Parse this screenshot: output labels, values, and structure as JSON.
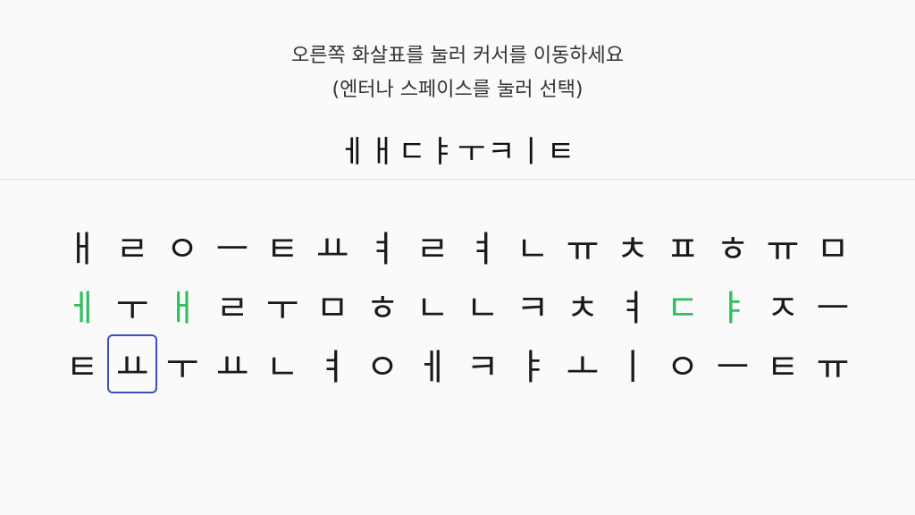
{
  "instructions": {
    "line1": "오른쪽 화살표를 눌러 커서를 이동하세요",
    "line2": "(엔터나 스페이스를 눌러 선택)"
  },
  "target_word": "ㅔㅐㄷㅑㅜㅋㅣㅌ",
  "colors": {
    "found": "#2fbf5f",
    "cursor_border": "#3a4fc2",
    "text": "#1a1a1a"
  },
  "grid": {
    "rows": [
      [
        "ㅐ",
        "ㄹ",
        "ㅇ",
        "ㅡ",
        "ㅌ",
        "ㅛ",
        "ㅕ",
        "ㄹ",
        "ㅕ",
        "ㄴ",
        "ㅠ",
        "ㅊ",
        "ㅍ",
        "ㅎ",
        "ㅠ",
        "ㅁ"
      ],
      [
        "ㅔ",
        "ㅜ",
        "ㅐ",
        "ㄹ",
        "ㅜ",
        "ㅁ",
        "ㅎ",
        "ㄴ",
        "ㄴ",
        "ㅋ",
        "ㅊ",
        "ㅕ",
        "ㄷ",
        "ㅑ",
        "ㅈ",
        "ㅡ"
      ],
      [
        "ㅌ",
        "ㅛ",
        "ㅜ",
        "ㅛ",
        "ㄴ",
        "ㅕ",
        "ㅇ",
        "ㅔ",
        "ㅋ",
        "ㅑ",
        "ㅗ",
        "ㅣ",
        "ㅇ",
        "ㅡ",
        "ㅌ",
        "ㅠ"
      ]
    ],
    "found": [
      [
        1,
        0
      ],
      [
        1,
        2
      ],
      [
        1,
        12
      ],
      [
        1,
        13
      ]
    ],
    "cursor": [
      2,
      1
    ]
  }
}
